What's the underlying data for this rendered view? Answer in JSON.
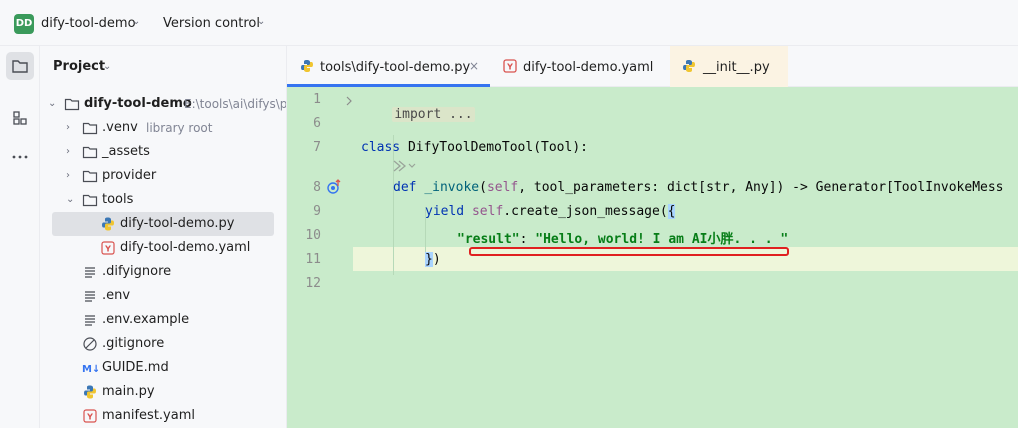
{
  "topbar": {
    "project_badge": "DD",
    "project_name": "dify-tool-demo",
    "vcs_label": "Version control"
  },
  "panel": {
    "title": "Project",
    "tree": [
      {
        "label": "dify-tool-demo",
        "hint": "E:\\tools\\ai\\difys\\p",
        "icon": "folder-icon",
        "expanded": true
      },
      {
        "label": ".venv",
        "hint": "library root",
        "icon": "folder-icon"
      },
      {
        "label": "_assets",
        "icon": "folder-icon"
      },
      {
        "label": "provider",
        "icon": "folder-icon"
      },
      {
        "label": "tools",
        "icon": "folder-icon",
        "expanded": true
      },
      {
        "label": "dify-tool-demo.py",
        "icon": "python-file-icon",
        "selected": true
      },
      {
        "label": "dify-tool-demo.yaml",
        "icon": "yaml-file-icon"
      },
      {
        "label": ".difyignore",
        "icon": "text-file-icon"
      },
      {
        "label": ".env",
        "icon": "text-file-icon"
      },
      {
        "label": ".env.example",
        "icon": "text-file-icon"
      },
      {
        "label": ".gitignore",
        "icon": "ignore-file-icon"
      },
      {
        "label": "GUIDE.md",
        "icon": "markdown-file-icon"
      },
      {
        "label": "main.py",
        "icon": "python-file-icon"
      },
      {
        "label": "manifest.yaml",
        "icon": "yaml-file-icon"
      }
    ]
  },
  "tabs": [
    {
      "label": "tools\\dify-tool-demo.py",
      "icon": "python-file-icon",
      "active": true,
      "close": "×"
    },
    {
      "label": "dify-tool-demo.yaml",
      "icon": "yaml-file-icon"
    },
    {
      "label": "__init__.py",
      "icon": "python-file-icon"
    }
  ],
  "editor": {
    "line_numbers": [
      "1",
      "6",
      "7",
      "8",
      "9",
      "10",
      "11",
      "12"
    ],
    "lines": {
      "l1": "import ...",
      "l7_kw": "class ",
      "l7_rest": "DifyToolDemoTool(Tool):",
      "l8_kw": "def ",
      "l8_fn": "_invoke",
      "l8_open": "(",
      "l8_self": "self",
      "l8_rest": ", tool_parameters: dict[str, Any]) -> Generator[ToolInvokeMess",
      "l9_kw": "yield ",
      "l9_self": "self",
      "l9_rest": ".create_json_message(",
      "l9_brace": "{",
      "l10_key": "\"result\"",
      "l10_colon": ": ",
      "l10_val": "\"Hello, world! I am AI小胖. . . \"",
      "l11_brace": "}",
      "l11_paren": ")"
    }
  }
}
